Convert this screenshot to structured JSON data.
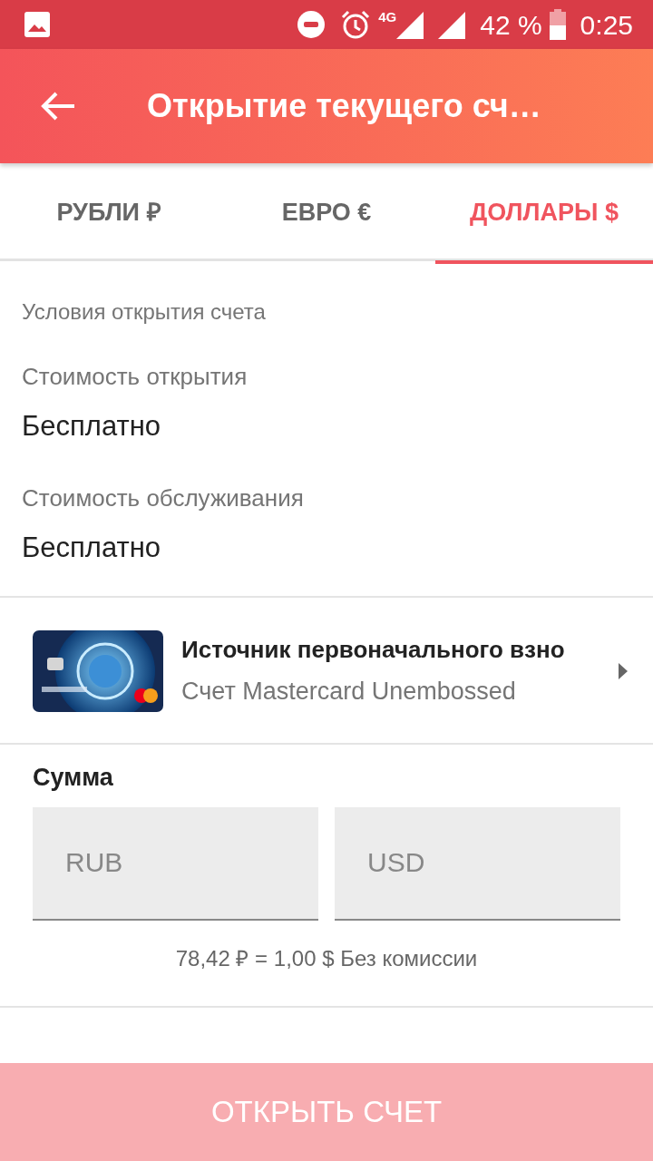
{
  "status_bar": {
    "network": "4G",
    "battery": "42 %",
    "time": "0:25"
  },
  "toolbar": {
    "title": "Открытие текущего сч…"
  },
  "tabs": [
    {
      "label": "РУБЛИ ₽",
      "selected": false
    },
    {
      "label": "ЕВРО €",
      "selected": false
    },
    {
      "label": "ДОЛЛАРЫ $",
      "selected": true
    }
  ],
  "conditions": {
    "heading": "Условия открытия счета",
    "items": [
      {
        "label": "Стоимость открытия",
        "value": "Бесплатно"
      },
      {
        "label": "Стоимость обслуживания",
        "value": "Бесплатно"
      }
    ]
  },
  "source": {
    "title": "Источник первоначального взно",
    "subtitle": "Счет Mastercard Unembossed"
  },
  "amount": {
    "heading": "Сумма",
    "fields": [
      {
        "placeholder": "RUB"
      },
      {
        "placeholder": "USD"
      }
    ],
    "rate": "78,42 ₽ = 1,00 $ Без комиссии"
  },
  "button": {
    "label": "ОТКРЫТЬ СЧЕТ",
    "disabled": true
  }
}
